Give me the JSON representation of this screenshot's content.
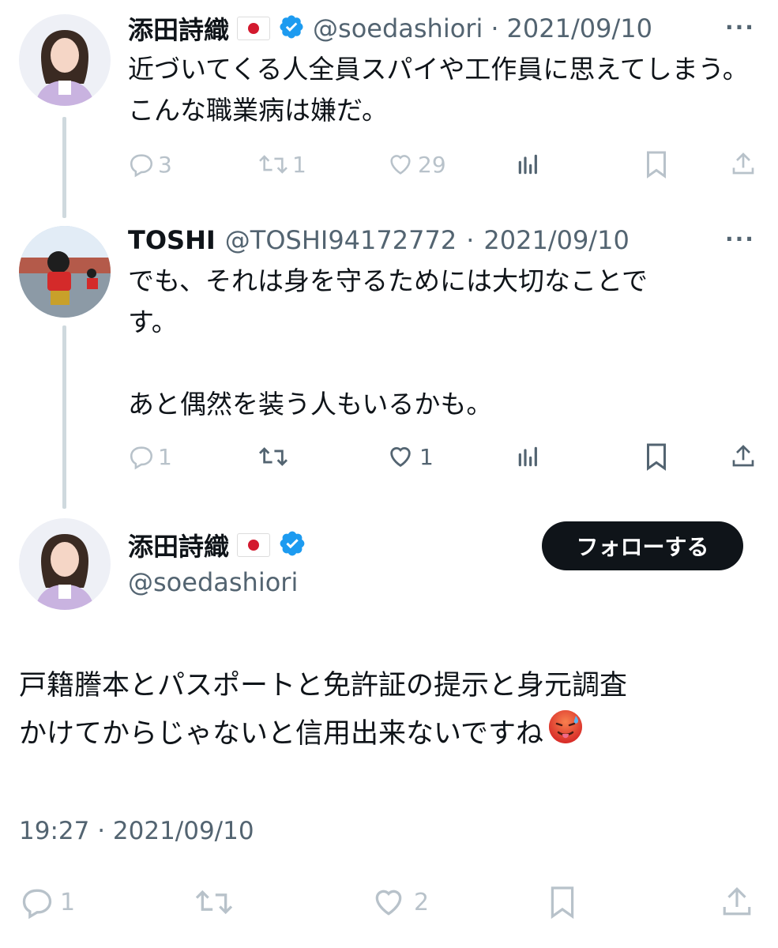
{
  "thread": [
    {
      "name": "添田詩織",
      "handle": "@soedashiori",
      "separator": "·",
      "date": "2021/09/10",
      "text": "近づいてくる人全員スパイや工作員に思えてしまう。こんな職業病は嫌だ。",
      "reply_count": "3",
      "retweet_count": "1",
      "like_count": "29",
      "more": "···",
      "verified": true,
      "flag_icon": "japan-flag-icon"
    },
    {
      "name": "TOSHI",
      "handle": "@TOSHI94172772",
      "separator": "·",
      "date": "2021/09/10",
      "text_line1": "でも、それは身を守るためには大切なことで",
      "text_line2": "す。",
      "text_line3": "あと偶然を装う人もいるかも。",
      "reply_count": "1",
      "retweet_count": "",
      "like_count": "1",
      "more": "···"
    }
  ],
  "main": {
    "name": "添田詩織",
    "handle": "@soedashiori",
    "follow_label": "フォローする",
    "text_line1": "戸籍謄本とパスポートと免許証の提示と身元調査",
    "text_line2": "かけてからじゃないと信用出来ないですね",
    "emoji": "hot-face-emoji",
    "timestamp": "19:27 · 2021/09/10",
    "reply_count": "1",
    "retweet_count": "",
    "like_count": "2"
  },
  "colors": {
    "text": "#0f1419",
    "secondary": "#536471",
    "verified": "#1d9bf0",
    "thread_line": "#cfd9de",
    "follow_bg": "#0f1419"
  }
}
